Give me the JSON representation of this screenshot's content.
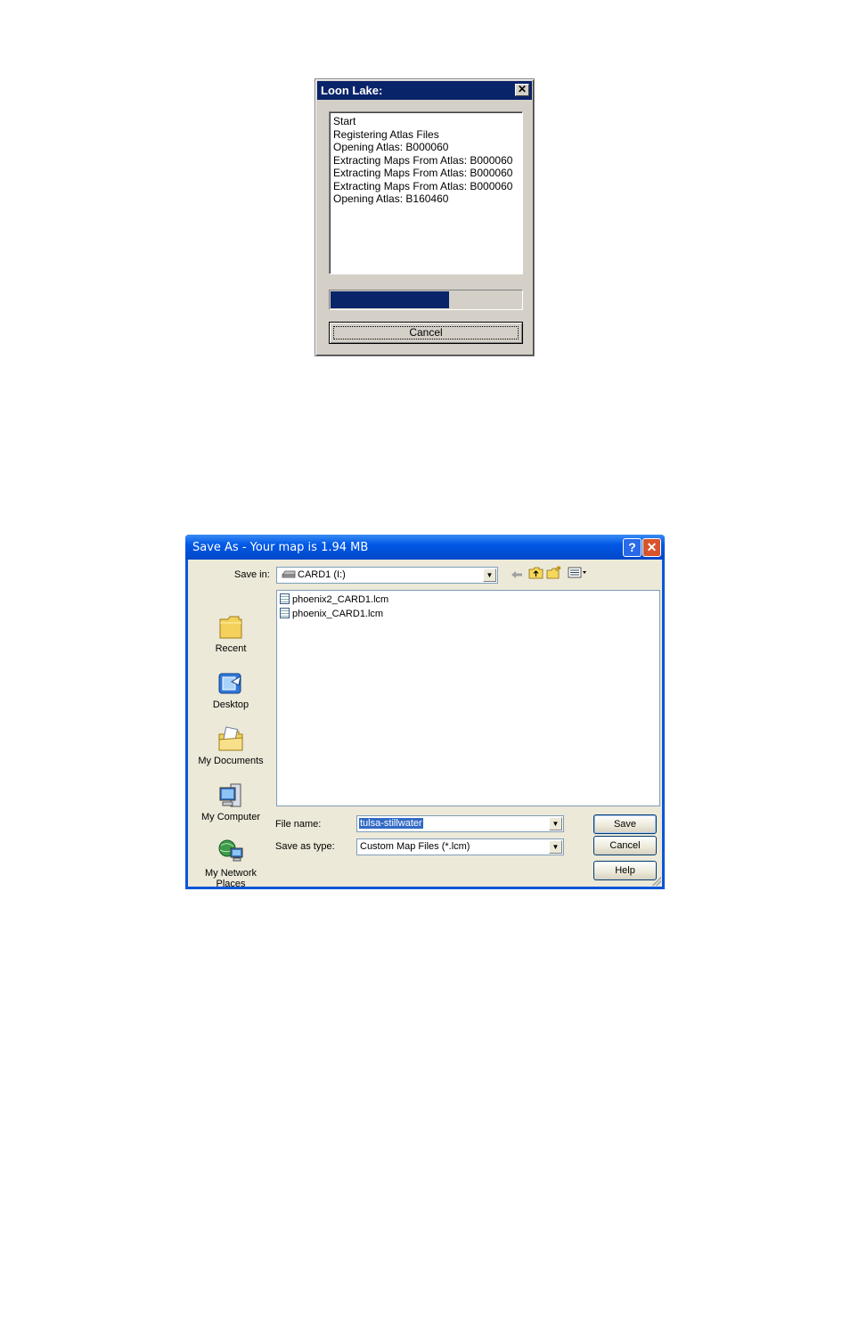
{
  "progress_dialog": {
    "title": "Loon Lake:",
    "close_glyph": "✕",
    "log": [
      "Start",
      "Registering Atlas Files",
      "Opening Atlas: B000060",
      "Extracting Maps From Atlas: B000060",
      "Extracting Maps From Atlas: B000060",
      "Extracting Maps From Atlas: B000060",
      "Opening Atlas: B160460"
    ],
    "progress_fraction": 0.62,
    "progress_color": "#0a246a",
    "cancel_label": "Cancel"
  },
  "saveas_dialog": {
    "title": "Save As - Your map is 1.94 MB",
    "help_glyph": "?",
    "close_glyph": "✕",
    "save_in_label": "Save in:",
    "save_in_value": "CARD1 (I:)",
    "toolbar_icons": [
      "back-icon",
      "up-folder-icon",
      "new-folder-icon",
      "view-menu-icon"
    ],
    "places": [
      "Recent",
      "Desktop",
      "My Documents",
      "My Computer",
      "My Network Places"
    ],
    "files": [
      "phoenix2_CARD1.lcm",
      "phoenix_CARD1.lcm"
    ],
    "file_name_label": "File name:",
    "file_name_value": "tulsa-stillwater",
    "save_type_label": "Save as type:",
    "save_type_value": "Custom Map Files (*.lcm)",
    "save_label": "Save",
    "cancel_label": "Cancel",
    "help_label": "Help",
    "titlebar_color": "#0058e6",
    "selection_color": "#316ac5"
  }
}
